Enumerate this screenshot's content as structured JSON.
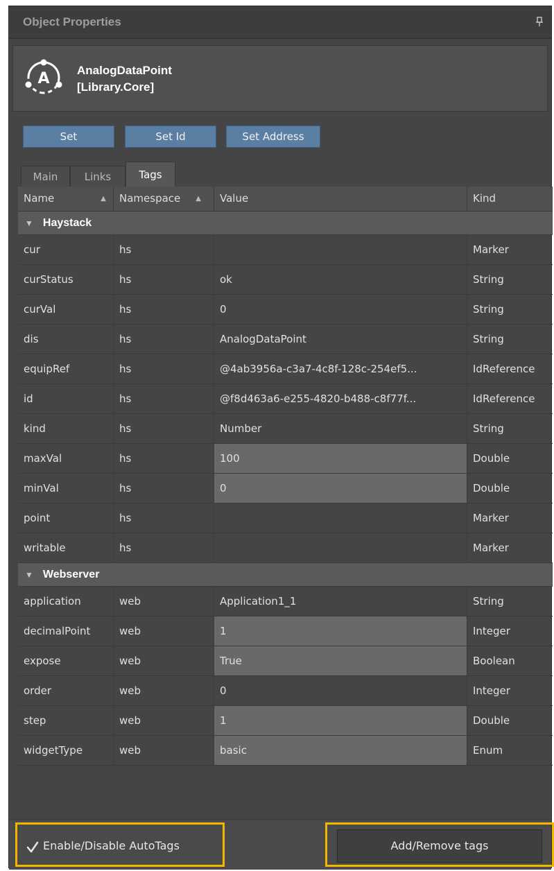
{
  "panel": {
    "title": "Object Properties",
    "object_name": "AnalogDataPoint",
    "object_library": "[Library.Core]",
    "object_icon_letter": "A"
  },
  "buttons": {
    "set": "Set",
    "set_id": "Set Id",
    "set_address": "Set Address"
  },
  "tabs": [
    {
      "label": "Main",
      "active": false
    },
    {
      "label": "Links",
      "active": false
    },
    {
      "label": "Tags",
      "active": true
    }
  ],
  "columns": {
    "name": "Name",
    "namespace": "Namespace",
    "value": "Value",
    "kind": "Kind",
    "sort_arrow": "▲"
  },
  "groups": [
    {
      "name": "Haystack",
      "rows": [
        {
          "name": "cur",
          "ns": "hs",
          "value": "",
          "kind": "Marker",
          "editable": false
        },
        {
          "name": "curStatus",
          "ns": "hs",
          "value": "ok",
          "kind": "String",
          "editable": false
        },
        {
          "name": "curVal",
          "ns": "hs",
          "value": "0",
          "kind": "String",
          "editable": false
        },
        {
          "name": "dis",
          "ns": "hs",
          "value": "AnalogDataPoint",
          "kind": "String",
          "editable": false
        },
        {
          "name": "equipRef",
          "ns": "hs",
          "value": "@4ab3956a-c3a7-4c8f-128c-254ef5...",
          "kind": "IdReference",
          "editable": false
        },
        {
          "name": "id",
          "ns": "hs",
          "value": "@f8d463a6-e255-4820-b488-c8f77f...",
          "kind": "IdReference",
          "editable": false
        },
        {
          "name": "kind",
          "ns": "hs",
          "value": "Number",
          "kind": "String",
          "editable": false
        },
        {
          "name": "maxVal",
          "ns": "hs",
          "value": "100",
          "kind": "Double",
          "editable": true
        },
        {
          "name": "minVal",
          "ns": "hs",
          "value": "0",
          "kind": "Double",
          "editable": true
        },
        {
          "name": "point",
          "ns": "hs",
          "value": "",
          "kind": "Marker",
          "editable": false
        },
        {
          "name": "writable",
          "ns": "hs",
          "value": "",
          "kind": "Marker",
          "editable": false
        }
      ]
    },
    {
      "name": "Webserver",
      "rows": [
        {
          "name": "application",
          "ns": "web",
          "value": "Application1_1",
          "kind": "String",
          "editable": false
        },
        {
          "name": "decimalPoint",
          "ns": "web",
          "value": "1",
          "kind": "Integer",
          "editable": true
        },
        {
          "name": "expose",
          "ns": "web",
          "value": "True",
          "kind": "Boolean",
          "editable": true
        },
        {
          "name": "order",
          "ns": "web",
          "value": "0",
          "kind": "Integer",
          "editable": false
        },
        {
          "name": "step",
          "ns": "web",
          "value": "1",
          "kind": "Double",
          "editable": true
        },
        {
          "name": "widgetType",
          "ns": "web",
          "value": "basic",
          "kind": "Enum",
          "editable": true
        }
      ]
    }
  ],
  "footer": {
    "autotags_label": "Enable/Disable AutoTags",
    "autotags_checked": true,
    "add_remove_label": "Add/Remove tags"
  },
  "colors": {
    "highlight": "#f2b600",
    "button": "#5b7ea3",
    "panel": "#454545"
  }
}
